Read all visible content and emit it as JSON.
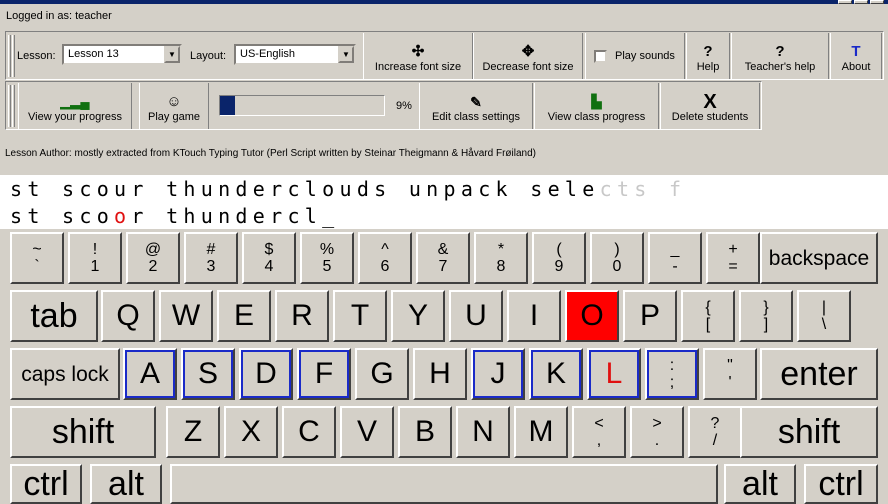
{
  "window": {
    "buttons": [
      "minimize",
      "maximize",
      "close"
    ]
  },
  "user": {
    "login_text": "Logged in as: teacher"
  },
  "toolbar1": {
    "lesson_label": "Lesson:",
    "lesson_value": "Lesson 13",
    "layout_label": "Layout:",
    "layout_value": "US-English",
    "increase_font": "Increase font size",
    "decrease_font": "Decrease font size",
    "play_sounds": "Play sounds",
    "help": "Help",
    "teachers_help": "Teacher's help",
    "about": "About",
    "help_icon": "?",
    "about_icon": "T"
  },
  "toolbar2": {
    "view_progress": "View your progress",
    "play_game": "Play game",
    "progress_percent": "9%",
    "progress_value": 0.09,
    "edit_class": "Edit class settings",
    "view_class": "View class progress",
    "delete_students": "Delete students",
    "delete_icon": "X",
    "game_icon": "☺"
  },
  "lesson_author": "Lesson Author: mostly extracted from KTouch Typing Tutor (Perl Script written by Steinar Theigmann & Håvard Frøiland)",
  "exercise": {
    "target_typed": "st scour thunderclouds unpack sele",
    "target_remaining": "cts f",
    "input_before_error": "st sco",
    "input_error_char": "o",
    "input_after_error": "r thundercl",
    "input_cursor": "_"
  },
  "keyboard": {
    "row1": [
      {
        "top": "~",
        "bot": "`"
      },
      {
        "top": "!",
        "bot": "1"
      },
      {
        "top": "@",
        "bot": "2"
      },
      {
        "top": "#",
        "bot": "3"
      },
      {
        "top": "$",
        "bot": "4"
      },
      {
        "top": "%",
        "bot": "5"
      },
      {
        "top": "^",
        "bot": "6"
      },
      {
        "top": "&",
        "bot": "7"
      },
      {
        "top": "*",
        "bot": "8"
      },
      {
        "top": "(",
        "bot": "9"
      },
      {
        "top": ")",
        "bot": "0"
      },
      {
        "top": "_",
        "bot": "-"
      },
      {
        "top": "+",
        "bot": "="
      }
    ],
    "backspace": "backspace",
    "tab": "tab",
    "row2": [
      "Q",
      "W",
      "E",
      "R",
      "T",
      "Y",
      "U",
      "I",
      "O",
      "P"
    ],
    "row2_sym": [
      {
        "top": "{",
        "bot": "["
      },
      {
        "top": "}",
        "bot": "]"
      },
      {
        "top": "|",
        "bot": "\\"
      }
    ],
    "caps": "caps lock",
    "row3": [
      "A",
      "S",
      "D",
      "F",
      "G",
      "H",
      "J",
      "K",
      "L"
    ],
    "row3_sym": [
      {
        "top": ":",
        "bot": ";"
      },
      {
        "top": "\"",
        "bot": "'"
      }
    ],
    "enter": "enter",
    "shift": "shift",
    "row4": [
      "Z",
      "X",
      "C",
      "V",
      "B",
      "N",
      "M"
    ],
    "row4_sym": [
      {
        "top": "<",
        "bot": ","
      },
      {
        "top": ">",
        "bot": "."
      },
      {
        "top": "?",
        "bot": "/"
      }
    ],
    "ctrl": "ctrl",
    "alt": "alt",
    "highlight_key": "O",
    "highlight_color": "#ff0000",
    "home_row_color": "#1a2ac8",
    "error_text_color": "#e01010"
  }
}
